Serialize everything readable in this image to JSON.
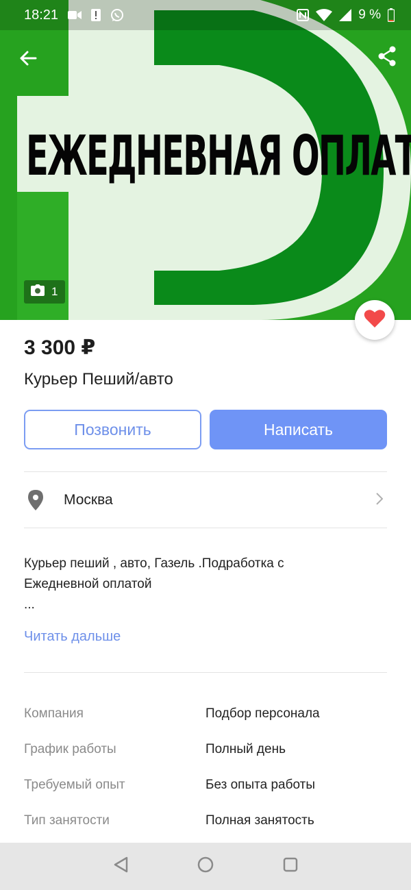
{
  "status_bar": {
    "time": "18:21",
    "battery": "9 %",
    "icons_left": [
      "video-icon",
      "alert-icon",
      "whatsapp-icon"
    ],
    "icons_right": [
      "nfc-icon",
      "wifi-icon",
      "signal-icon",
      "battery-icon"
    ]
  },
  "hero": {
    "banner_text": "ЕЖЕДНЕВНАЯ ОПЛАТА",
    "photo_count": "1",
    "colors": {
      "green": "#26a21f",
      "light": "#e4f3e1"
    }
  },
  "listing": {
    "price": "3 300 ₽",
    "title": "Курьер Пеший/авто"
  },
  "actions": {
    "call_label": "Позвонить",
    "write_label": "Написать",
    "accent": "#6f94f6"
  },
  "location": {
    "city": "Москва"
  },
  "description": {
    "line1": "Курьер пеший , авто, Газель .Подработка с",
    "line2": "Ежедневной оплатой",
    "ellipsis": "...",
    "read_more": "Читать дальше"
  },
  "params": [
    {
      "label": "Компания",
      "value": "Подбор персонала"
    },
    {
      "label": "График работы",
      "value": "Полный день"
    },
    {
      "label": "Требуемый опыт",
      "value": "Без опыта работы"
    },
    {
      "label": "Тип занятости",
      "value": "Полная занятость"
    }
  ],
  "favorite": {
    "active": true,
    "color": "#f24a4a"
  },
  "nav": [
    "back-triangle-icon",
    "home-circle-icon",
    "recents-square-icon"
  ]
}
